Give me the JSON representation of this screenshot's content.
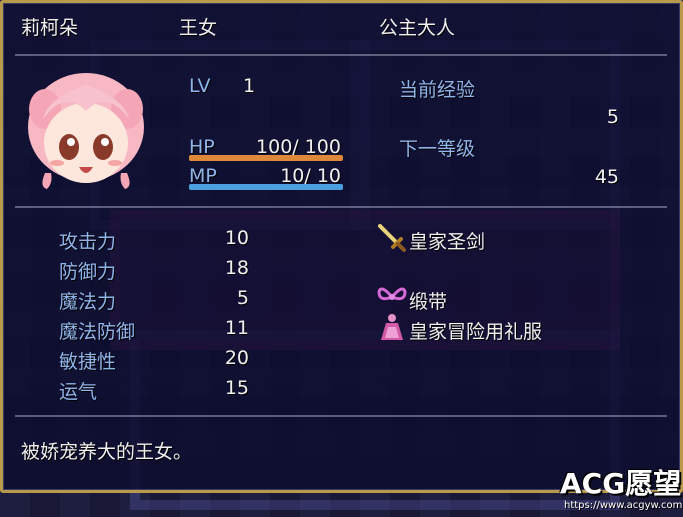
{
  "header": {
    "name": "莉柯朵",
    "class": "王女",
    "title": "公主大人"
  },
  "status": {
    "lv_label": "LV",
    "lv_value": "1",
    "hp_label": "HP",
    "hp_value": "100/ 100",
    "hp_fraction": 1.0,
    "mp_label": "MP",
    "mp_value": "10/  10",
    "mp_fraction": 1.0,
    "exp_label": "当前经验",
    "exp_value": "5",
    "next_label": "下一等级",
    "next_value": "45"
  },
  "params": [
    {
      "label": "攻击力",
      "value": "10"
    },
    {
      "label": "防御力",
      "value": "18"
    },
    {
      "label": "魔法力",
      "value": "5"
    },
    {
      "label": "魔法防御",
      "value": "11"
    },
    {
      "label": "敏捷性",
      "value": "20"
    },
    {
      "label": "运气",
      "value": "15"
    }
  ],
  "equipment": [
    {
      "name": "皇家圣剑",
      "icon": "sword-icon"
    },
    {
      "name": "",
      "icon": ""
    },
    {
      "name": "缎带",
      "icon": "ribbon-icon"
    },
    {
      "name": "皇家冒险用礼服",
      "icon": "dress-icon"
    }
  ],
  "description": "被娇宠养大的王女。",
  "watermark": {
    "main": "ACG愿望",
    "url": "https://www.acgyw.com"
  },
  "colors": {
    "hp_bar": "#e0883a",
    "mp_bar": "#4aa0e0",
    "label_blue": "#8fb4e8",
    "border_gold": "#b89a4a"
  }
}
